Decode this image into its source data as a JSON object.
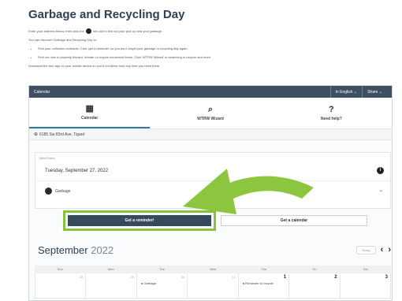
{
  "page": {
    "title": "Garbage and Recycling Day",
    "intro_line1_a": "Enter your address below, then click the",
    "intro_line1_b": "info dot to find out your pick up and your garbage.",
    "intro_line2": "You can discover Garbage and Recycling Day to:",
    "bullet1": "Find your collection schedule. Click 'get a reminder' so you don't forget your garbage or recycling day again.",
    "bullet2": "Find out how to properly discard, donate or recycle household items. Click 'WTRW Wizard' to searching to recycle and more.",
    "intro_line3": "Download the free app on your mobile device so you'd not these hold any time you need them."
  },
  "header": {
    "left": "Calendar",
    "language": "In English ⌄",
    "share": "Share ⌄"
  },
  "nav": {
    "calendar": "Calendar",
    "wizard": "WTRW Wizard",
    "help": "Need help?"
  },
  "address": "6185 Sw 83rd Ave, Tigard",
  "event": {
    "label": "Next Event",
    "date": "Tuesday, September 27, 2022",
    "type": "Garbage"
  },
  "actions": {
    "reminder": "Get a reminder!",
    "calendar": "Get a calendar"
  },
  "month": {
    "name": "September",
    "year": "2022",
    "today": "Today"
  },
  "weekdays": [
    "Sun",
    "Mon",
    "Tue",
    "Wed",
    "Thu",
    "Fri",
    "Sat"
  ],
  "week1": {
    "d0": "28",
    "d1": "29",
    "d2": "30",
    "d3": "31",
    "d4": "1",
    "d5": "2",
    "d6": "3",
    "e2": "● Garbage",
    "e4": "● Reminder to recycle"
  },
  "colors": {
    "accent": "#37495c",
    "highlight": "#86c23a",
    "arrow": "#8cc63f"
  }
}
